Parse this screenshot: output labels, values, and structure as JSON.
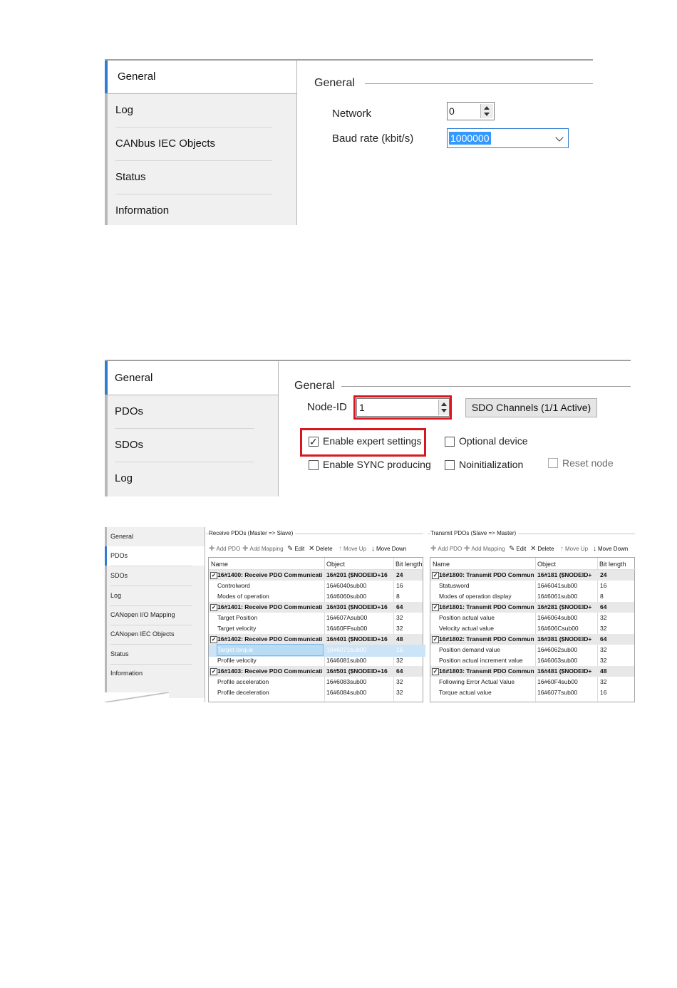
{
  "panel1": {
    "tabs": [
      "General",
      "Log",
      "CANbus IEC Objects",
      "Status",
      "Information"
    ],
    "group_title": "General",
    "network_label": "Network",
    "network_value": "0",
    "baud_label": "Baud rate (kbit/s)",
    "baud_value": "1000000"
  },
  "panel2": {
    "tabs": [
      "General",
      "PDOs",
      "SDOs",
      "Log"
    ],
    "group_title": "General",
    "node_id_label": "Node-ID",
    "node_id_value": "1",
    "sdo_button": "SDO Channels (1/1 Active)",
    "enable_expert": "Enable expert settings",
    "optional_device": "Optional device",
    "enable_sync": "Enable SYNC producing",
    "no_initialization": "Noinitialization",
    "reset_node": "Reset node"
  },
  "panel3": {
    "tabs": [
      "General",
      "PDOs",
      "SDOs",
      "Log",
      "CANopen I/O Mapping",
      "CANopen IEC Objects",
      "Status",
      "Information"
    ],
    "toolbar": [
      "Add PDO",
      "Add Mapping",
      "Edit",
      "Delete",
      "Move Up",
      "Move Down"
    ],
    "columns": [
      "Name",
      "Object",
      "Bit length"
    ],
    "receive": {
      "title": "Receive PDOs (Master => Slave)",
      "rows": [
        {
          "g": true,
          "n": "16#1400: Receive PDO Communicati",
          "o": "16#201 ($NODEID+16",
          "b": "24"
        },
        {
          "g": false,
          "n": "Controlword",
          "o": "16#6040sub00",
          "b": "16"
        },
        {
          "g": false,
          "n": "Modes of operation",
          "o": "16#6060sub00",
          "b": "8"
        },
        {
          "g": true,
          "n": "16#1401: Receive PDO Communicati",
          "o": "16#301 ($NODEID+16",
          "b": "64"
        },
        {
          "g": false,
          "n": "Target Position",
          "o": "16#607Asub00",
          "b": "32"
        },
        {
          "g": false,
          "n": "Target velocity",
          "o": "16#60FFsub00",
          "b": "32"
        },
        {
          "g": true,
          "n": "16#1402: Receive PDO Communicati",
          "o": "16#401 ($NODEID+16",
          "b": "48"
        },
        {
          "g": false,
          "s": true,
          "n": "Target torque",
          "o": "16#6071sub00",
          "b": "16"
        },
        {
          "g": false,
          "n": "Profile velocity",
          "o": "16#6081sub00",
          "b": "32"
        },
        {
          "g": true,
          "n": "16#1403: Receive PDO Communicati",
          "o": "16#501 ($NODEID+16",
          "b": "64"
        },
        {
          "g": false,
          "n": "Profile acceleration",
          "o": "16#6083sub00",
          "b": "32"
        },
        {
          "g": false,
          "n": "Profile deceleration",
          "o": "16#6084sub00",
          "b": "32"
        }
      ]
    },
    "transmit": {
      "title": "Transmit PDOs (Slave => Master)",
      "rows": [
        {
          "g": true,
          "n": "16#1800: Transmit PDO Commun",
          "o": "16#181 ($NODEID+",
          "b": "24"
        },
        {
          "g": false,
          "n": "Statusword",
          "o": "16#6041sub00",
          "b": "16"
        },
        {
          "g": false,
          "n": "Modes of operation display",
          "o": "16#6061sub00",
          "b": "8"
        },
        {
          "g": true,
          "n": "16#1801: Transmit PDO Commun",
          "o": "16#281 ($NODEID+",
          "b": "64"
        },
        {
          "g": false,
          "n": "Position actual value",
          "o": "16#6064sub00",
          "b": "32"
        },
        {
          "g": false,
          "n": "Velocity actual value",
          "o": "16#606Csub00",
          "b": "32"
        },
        {
          "g": true,
          "n": "16#1802: Transmit PDO Commun",
          "o": "16#381 ($NODEID+",
          "b": "64"
        },
        {
          "g": false,
          "n": "Position demand value",
          "o": "16#6062sub00",
          "b": "32"
        },
        {
          "g": false,
          "n": "Position actual increment value",
          "o": "16#6063sub00",
          "b": "32"
        },
        {
          "g": true,
          "n": "16#1803: Transmit PDO Commun",
          "o": "16#481 ($NODEID+",
          "b": "48"
        },
        {
          "g": false,
          "n": "Following Error Actual Value",
          "o": "16#60F4sub00",
          "b": "32"
        },
        {
          "g": false,
          "n": "Torque actual value",
          "o": "16#6077sub00",
          "b": "16"
        }
      ]
    }
  }
}
